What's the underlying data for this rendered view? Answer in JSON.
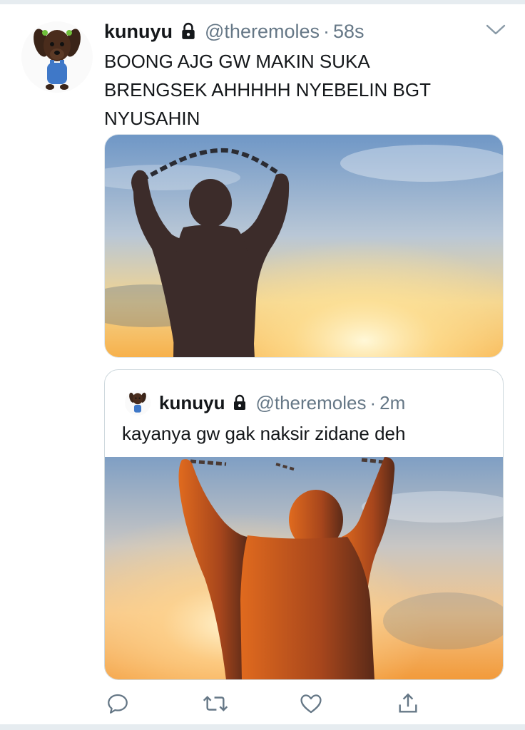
{
  "tweet": {
    "name": "kunuyu",
    "handle": "@theremoles",
    "separator": "·",
    "time": "58s",
    "text": "BOONG AJG GW MAKIN SUKA\nBRENGSEK AHHHHH NYEBELIN BGT\nNYUSAHIN"
  },
  "quoted": {
    "name": "kunuyu",
    "handle": "@theremoles",
    "separator": "·",
    "time": "2m",
    "text": "kayanya gw gak naksir zidane deh"
  },
  "icons": {
    "lock": "lock-icon",
    "chevron": "chevron-down-icon",
    "reply": "reply-icon",
    "retweet": "retweet-icon",
    "like": "like-icon",
    "share": "share-icon"
  },
  "colors": {
    "text": "#14171a",
    "secondary": "#657786",
    "action_icons": "#657786"
  }
}
